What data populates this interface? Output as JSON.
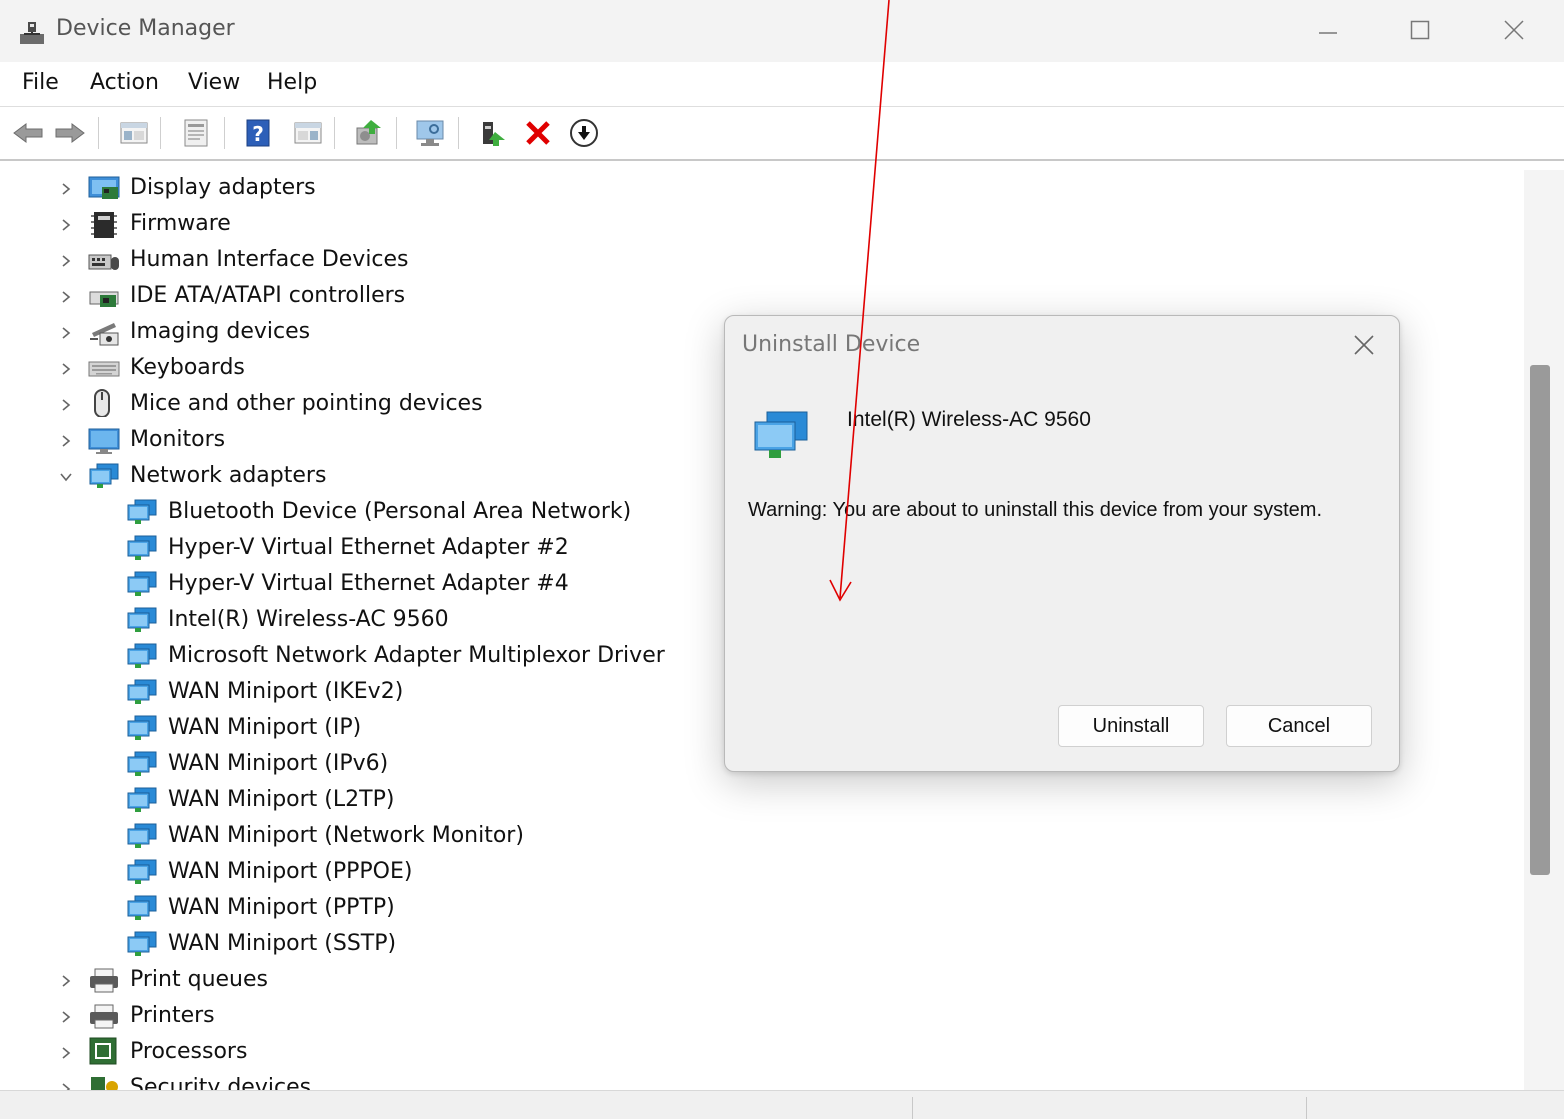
{
  "window": {
    "title": "Device Manager",
    "minimize_icon": "minimize-icon",
    "maximize_icon": "maximize-icon",
    "close_icon": "close-icon"
  },
  "menu": {
    "items": [
      "File",
      "Action",
      "View",
      "Help"
    ]
  },
  "toolbar": {
    "buttons": [
      "back-arrow-icon",
      "forward-arrow-icon",
      "show-hide-console-tree-icon",
      "properties-icon",
      "help-icon",
      "action-pane-icon",
      "update-driver-icon",
      "scan-hardware-icon",
      "add-driver-icon",
      "uninstall-icon",
      "disable-icon"
    ]
  },
  "tree": {
    "categories": [
      {
        "label": "Display adapters",
        "icon": "display-adapter-icon",
        "expanded": false
      },
      {
        "label": "Firmware",
        "icon": "firmware-icon",
        "expanded": false
      },
      {
        "label": "Human Interface Devices",
        "icon": "hid-icon",
        "expanded": false
      },
      {
        "label": "IDE ATA/ATAPI controllers",
        "icon": "ide-controller-icon",
        "expanded": false
      },
      {
        "label": "Imaging devices",
        "icon": "camera-icon",
        "expanded": false
      },
      {
        "label": "Keyboards",
        "icon": "keyboard-icon",
        "expanded": false
      },
      {
        "label": "Mice and other pointing devices",
        "icon": "mouse-icon",
        "expanded": false
      },
      {
        "label": "Monitors",
        "icon": "monitor-icon",
        "expanded": false
      },
      {
        "label": "Network adapters",
        "icon": "network-adapter-icon",
        "expanded": true
      }
    ],
    "network_adapters": [
      "Bluetooth Device (Personal Area Network)",
      "Hyper-V Virtual Ethernet Adapter #2",
      "Hyper-V Virtual Ethernet Adapter #4",
      "Intel(R) Wireless-AC 9560",
      "Microsoft Network Adapter Multiplexor Driver",
      "WAN Miniport (IKEv2)",
      "WAN Miniport (IP)",
      "WAN Miniport (IPv6)",
      "WAN Miniport (L2TP)",
      "WAN Miniport (Network Monitor)",
      "WAN Miniport (PPPOE)",
      "WAN Miniport (PPTP)",
      "WAN Miniport (SSTP)"
    ],
    "categories_after": [
      {
        "label": "Print queues",
        "icon": "printer-icon",
        "expanded": false
      },
      {
        "label": "Printers",
        "icon": "printer-icon",
        "expanded": false
      },
      {
        "label": "Processors",
        "icon": "processor-icon",
        "expanded": false
      },
      {
        "label": "Security devices",
        "icon": "security-device-icon",
        "expanded": false
      }
    ]
  },
  "dialog": {
    "title": "Uninstall Device",
    "device_name": "Intel(R) Wireless-AC 9560",
    "warning": "Warning: You are about to uninstall this device from your system.",
    "uninstall_label": "Uninstall",
    "cancel_label": "Cancel"
  },
  "colors": {
    "annotation_arrow": "#e00000",
    "uninstall_x": "#e00000",
    "net_icon_blue": "#2a8ad6"
  }
}
